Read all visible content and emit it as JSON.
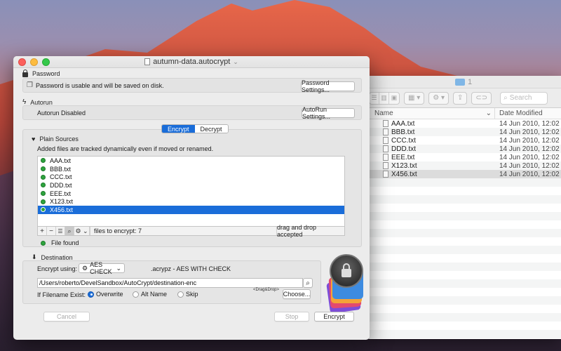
{
  "finder": {
    "folder_title": "1",
    "search_placeholder": "Search",
    "col_name": "Name",
    "col_date": "Date Modified",
    "files": [
      {
        "name": "AAA.txt",
        "date": "14 Jun 2010, 12:02"
      },
      {
        "name": "BBB.txt",
        "date": "14 Jun 2010, 12:02"
      },
      {
        "name": "CCC.txt",
        "date": "14 Jun 2010, 12:02"
      },
      {
        "name": "DDD.txt",
        "date": "14 Jun 2010, 12:02"
      },
      {
        "name": "EEE.txt",
        "date": "14 Jun 2010, 12:02"
      },
      {
        "name": "X123.txt",
        "date": "14 Jun 2010, 12:02"
      },
      {
        "name": "X456.txt",
        "date": "14 Jun 2010, 12:02"
      }
    ]
  },
  "window": {
    "title": "autumn-data.autocrypt",
    "password": {
      "section": "Password",
      "status": "Password is usable and will be saved on disk.",
      "button": "Password Settings..."
    },
    "autorun": {
      "section": "Autorun",
      "status": "Autorun Disabled",
      "button": "AutoRun Settings..."
    },
    "tabs": {
      "encrypt": "Encrypt",
      "decrypt": "Decrypt"
    },
    "sources": {
      "section": "Plain Sources",
      "hint": "Added files are tracked dynamically  even if moved or renamed.",
      "items": [
        "AAA.txt",
        "BBB.txt",
        "CCC.txt",
        "DDD.txt",
        "EEE.txt",
        "X123.txt",
        "X456.txt"
      ],
      "count_text": "files to encrypt: 7",
      "drag_text": "drag and drop accepted",
      "status": "File found"
    },
    "destination": {
      "section": "Destination",
      "encrypt_using_label": "Encrypt using:",
      "method": "AES CHECK",
      "extension_desc": ".acrypz - AES WITH CHECK",
      "path": "/Users/roberto/DevelSandbox/AutoCrypt/destination-enc",
      "filename_exists_label": "If Filename Exist:",
      "opt_overwrite": "Overwrite",
      "opt_altname": "Alt Name",
      "opt_skip": "Skip",
      "drag_drop_small": "<Drag&Drop>",
      "choose_button": "Choose..."
    },
    "actions": {
      "cancel": "Cancel",
      "stop": "Stop",
      "encrypt": "Encrypt"
    }
  }
}
